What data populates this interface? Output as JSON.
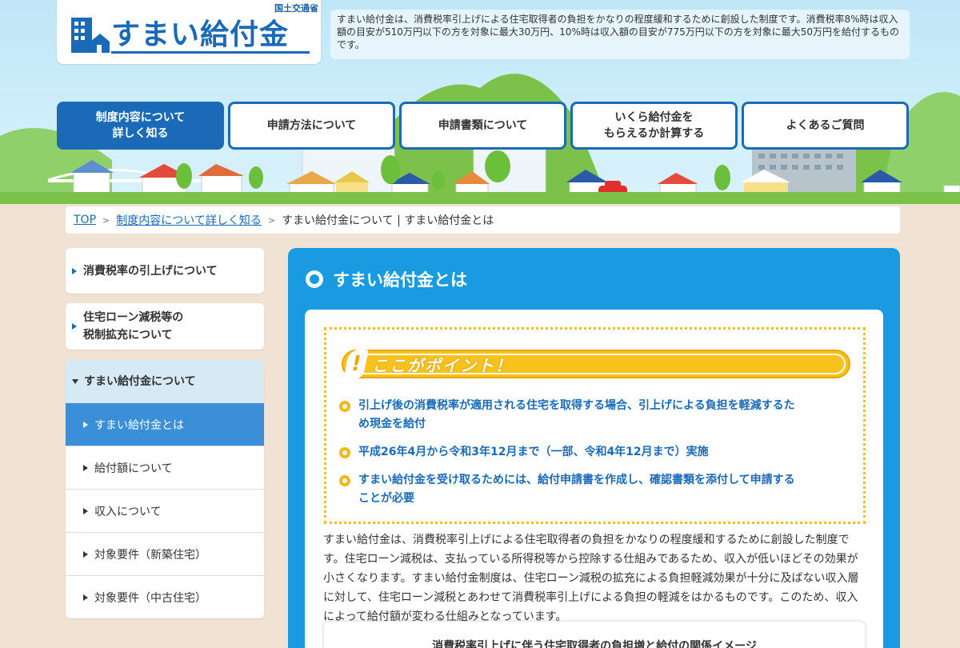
{
  "header": {
    "ministry": "国土交通省",
    "logo_text": "すまい給付金",
    "intro": "すまい給付金は、消費税率引上げによる住宅取得者の負担をかなりの程度緩和するために創設した制度です。消費税率8%時は収入額の目安が510万円以下の方を対象に最大30万円、10%時は収入額の目安が775万円以下の方を対象に最大50万円を給付するものです。"
  },
  "nav": [
    {
      "line1": "制度内容について",
      "line2": "詳しく知る",
      "active": true
    },
    {
      "line1": "申請方法について",
      "line2": "",
      "active": false
    },
    {
      "line1": "申請書類について",
      "line2": "",
      "active": false
    },
    {
      "line1": "いくら給付金を",
      "line2": "もらえるか計算する",
      "active": false
    },
    {
      "line1": "よくあるご質問",
      "line2": "",
      "active": false
    }
  ],
  "breadcrumb": {
    "top": "TOP",
    "level1": "制度内容について詳しく知る",
    "current": "すまい給付金について | すまい給付金とは"
  },
  "sidebar": {
    "item1": "消費税率の引上げについて",
    "item2_line1": "住宅ローン減税等の",
    "item2_line2": "税制拡充について",
    "item3": "すまい給付金について",
    "sub_items": [
      {
        "label": "すまい給付金とは",
        "active": true
      },
      {
        "label": "給付額について",
        "active": false
      },
      {
        "label": "収入について",
        "active": false
      },
      {
        "label": "対象要件（新築住宅）",
        "active": false
      },
      {
        "label": "対象要件（中古住宅）",
        "active": false
      }
    ]
  },
  "main": {
    "title": "すまい給付金とは",
    "point_label": "ここがポイント！",
    "point_mark": "!",
    "points": [
      {
        "line1": "引上げ後の消費税率が適用される住宅を取得する場合、引上げによる負担を軽減するた",
        "line2": "め現金を給付"
      },
      {
        "line1": "平成26年4月から令和3年12月まで（一部、令和4年12月まで）実施",
        "line2": ""
      },
      {
        "line1": "すまい給付金を受け取るためには、給付申請書を作成し、確認書類を添付して申請する",
        "line2": "ことが必要"
      }
    ],
    "body": "すまい給付金は、消費税率引上げによる住宅取得者の負担をかなりの程度緩和するために創設した制度です。住宅ローン減税は、支払っている所得税等から控除する仕組みであるため、収入が低いほどその効果が小さくなります。すまい給付金制度は、住宅ローン減税の拡充による負担軽減効果が十分に及ばない収入層に対して、住宅ローン減税とあわせて消費税率引上げによる負担の軽減をはかるものです。このため、収入によって給付額が変わる仕組みとなっています。",
    "diagram_title": "消費税率引上げに伴う住宅取得者の負担増と給付の関係イメージ"
  },
  "colors": {
    "brand_blue": "#1a6ab8",
    "panel_blue": "#1a9ae0",
    "point_yellow": "#f7c21c",
    "page_bg": "#f0e3d4"
  }
}
